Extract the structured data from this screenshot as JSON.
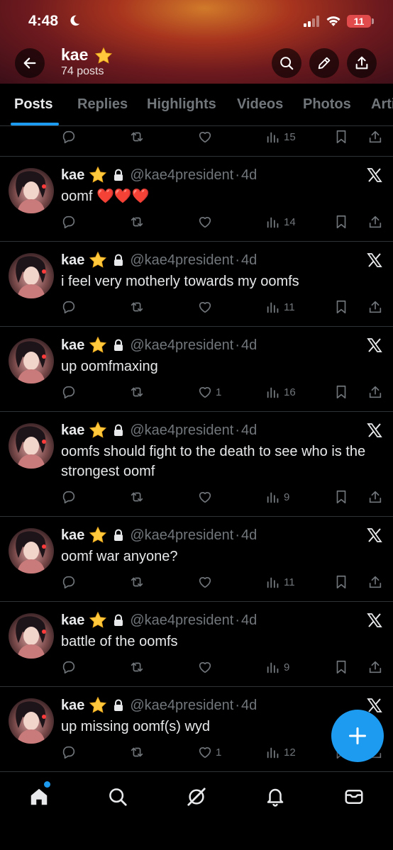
{
  "status_bar": {
    "time": "4:48",
    "battery": "11"
  },
  "header": {
    "name": "kae",
    "posts_label": "74 posts"
  },
  "tabs": [
    {
      "label": "Posts",
      "active": true
    },
    {
      "label": "Replies"
    },
    {
      "label": "Highlights"
    },
    {
      "label": "Videos"
    },
    {
      "label": "Photos"
    },
    {
      "label": "Articles"
    }
  ],
  "top_partial_actions": {
    "views": "15"
  },
  "tweets": [
    {
      "name": "kae",
      "handle": "@kae4president",
      "time": "4d",
      "text": "oomf ❤️❤️❤️",
      "likes": "",
      "views": "14"
    },
    {
      "name": "kae",
      "handle": "@kae4president",
      "time": "4d",
      "text": "i feel very motherly towards my oomfs",
      "likes": "",
      "views": "11"
    },
    {
      "name": "kae",
      "handle": "@kae4president",
      "time": "4d",
      "text": "up oomfmaxing",
      "likes": "1",
      "views": "16"
    },
    {
      "name": "kae",
      "handle": "@kae4president",
      "time": "4d",
      "text": "oomfs should fight to the death to see who is the strongest oomf",
      "likes": "",
      "views": "9"
    },
    {
      "name": "kae",
      "handle": "@kae4president",
      "time": "4d",
      "text": "oomf war anyone?",
      "likes": "",
      "views": "11"
    },
    {
      "name": "kae",
      "handle": "@kae4president",
      "time": "4d",
      "text": "battle of the oomfs",
      "likes": "",
      "views": "9"
    },
    {
      "name": "kae",
      "handle": "@kae4president",
      "time": "4d",
      "text": "up missing oomf(s) wyd",
      "likes": "1",
      "views": "12"
    }
  ],
  "colors": {
    "accent": "#1d9bf0",
    "muted": "#71767b",
    "text": "#e7e9ea",
    "star": "#ffc83d",
    "heart": "#e0242e"
  }
}
